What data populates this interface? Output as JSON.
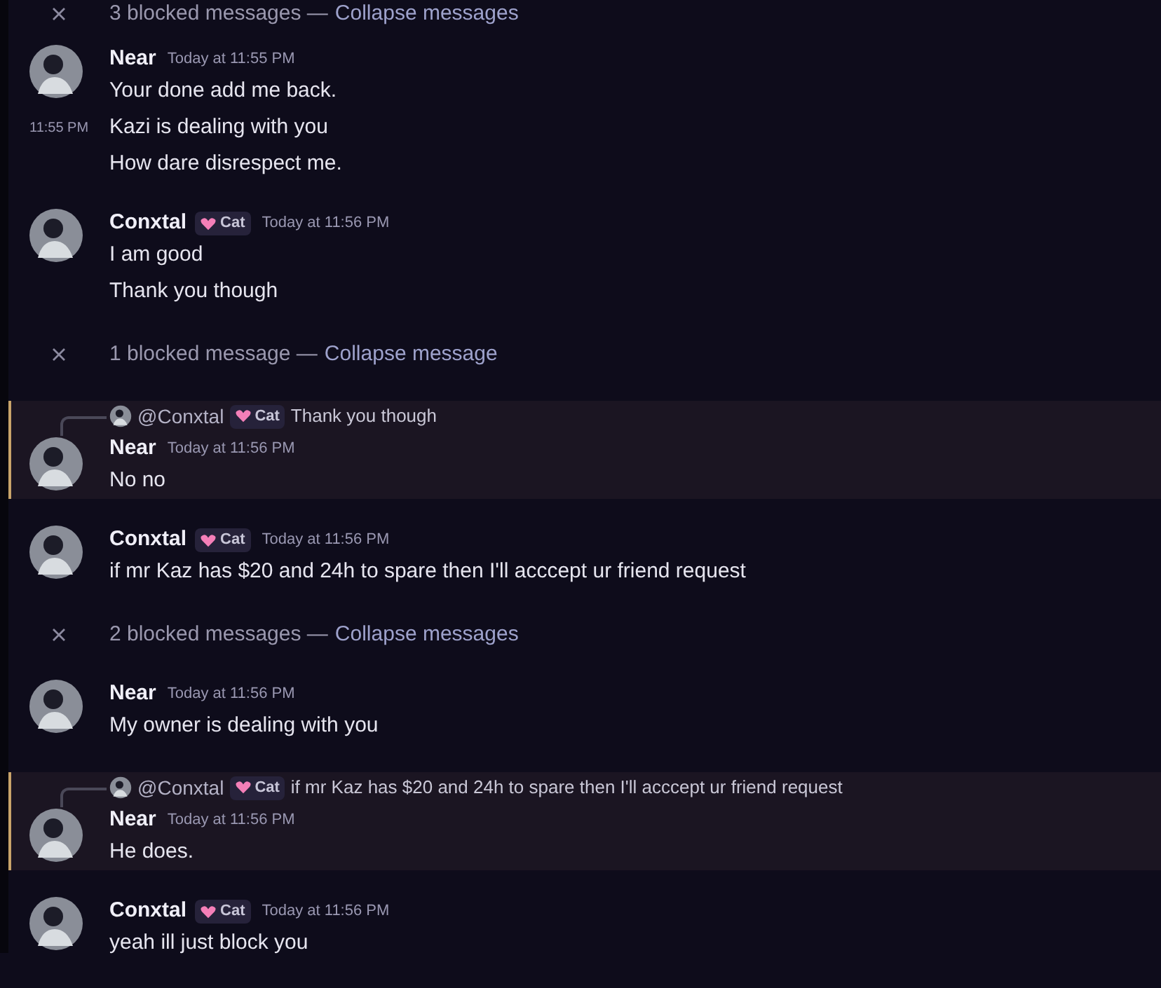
{
  "items": [
    {
      "kind": "blocked",
      "count_text": "3 blocked messages —",
      "link": "Collapse messages"
    },
    {
      "kind": "message",
      "author": "Near",
      "timestamp": "Today at 11:55 PM",
      "highlighted": false,
      "lines": [
        {
          "text": "Your done add me back."
        },
        {
          "text": "Kazi is dealing with you",
          "hover_time": "11:55 PM"
        },
        {
          "text": "How dare disrespect me."
        }
      ]
    },
    {
      "kind": "message",
      "author": "Conxtal",
      "tag": "Cat",
      "timestamp": "Today at 11:56 PM",
      "highlighted": false,
      "lines": [
        {
          "text": "I am good"
        },
        {
          "text": "Thank you though"
        }
      ]
    },
    {
      "kind": "blocked",
      "count_text": "1 blocked message —",
      "link": "Collapse message"
    },
    {
      "kind": "message",
      "author": "Near",
      "timestamp": "Today at 11:56 PM",
      "highlighted": true,
      "reply": {
        "author": "@Conxtal",
        "tag": "Cat",
        "text": "Thank you though"
      },
      "lines": [
        {
          "text": "No no"
        }
      ]
    },
    {
      "kind": "message",
      "author": "Conxtal",
      "tag": "Cat",
      "timestamp": "Today at 11:56 PM",
      "highlighted": false,
      "lines": [
        {
          "text": "if mr Kaz has $20 and 24h to spare then I'll acccept ur friend request"
        }
      ]
    },
    {
      "kind": "blocked",
      "count_text": "2 blocked messages —",
      "link": "Collapse messages"
    },
    {
      "kind": "message",
      "author": "Near",
      "timestamp": "Today at 11:56 PM",
      "highlighted": false,
      "lines": [
        {
          "text": "My owner is dealing with you"
        }
      ]
    },
    {
      "kind": "message",
      "author": "Near",
      "timestamp": "Today at 11:56 PM",
      "highlighted": true,
      "reply": {
        "author": "@Conxtal",
        "tag": "Cat",
        "text": "if mr Kaz has $20 and 24h to spare then I'll acccept ur friend request"
      },
      "lines": [
        {
          "text": "He does."
        }
      ]
    },
    {
      "kind": "message",
      "author": "Conxtal",
      "tag": "Cat",
      "timestamp": "Today at 11:56 PM",
      "highlighted": false,
      "lines": [
        {
          "text": "yeah ill just block you"
        }
      ]
    }
  ]
}
